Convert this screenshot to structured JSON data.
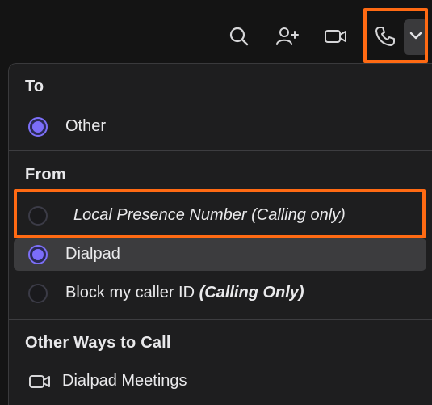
{
  "toolbar": {
    "icons": [
      "search-icon",
      "add-person-icon",
      "video-icon",
      "phone-icon",
      "chevron-down-icon"
    ]
  },
  "menu": {
    "to_section": {
      "title": "To",
      "options": [
        {
          "label": "Other",
          "checked": true
        }
      ]
    },
    "from_section": {
      "title": "From",
      "options": [
        {
          "label": "Local Presence Number (Calling only)",
          "checked": false,
          "italic": true
        },
        {
          "label": "Dialpad",
          "checked": true,
          "highlighted": true
        },
        {
          "label": "Block my caller ID ",
          "suffix": "(Calling Only)",
          "checked": false
        }
      ]
    },
    "other_section": {
      "title": "Other Ways to Call",
      "items": [
        {
          "label": "Dialpad Meetings",
          "icon": "video-icon"
        }
      ]
    }
  },
  "colors": {
    "accent": "#7b6df9",
    "annotation": "#ff6a13",
    "background": "#1e1e1f",
    "highlight_row": "#3c3c3e"
  }
}
